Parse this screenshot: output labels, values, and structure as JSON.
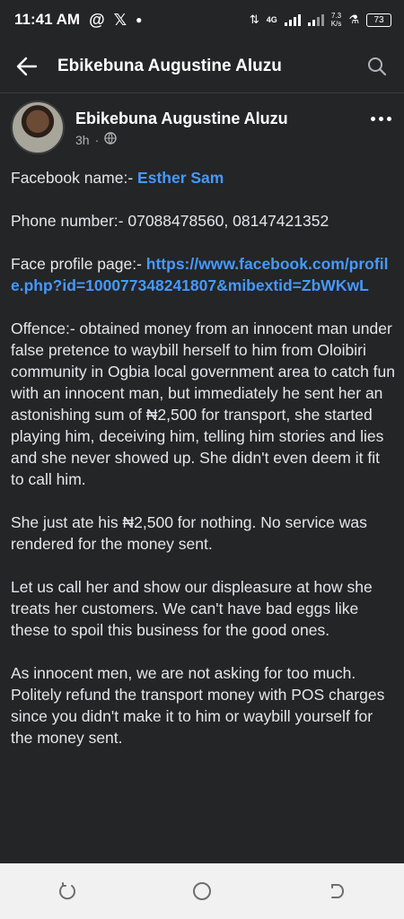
{
  "status_bar": {
    "time": "11:41 AM",
    "network": "4G",
    "speed_value": "7.3",
    "speed_unit": "K/s",
    "battery": "73"
  },
  "app_bar": {
    "title": "Ebikebuna Augustine Aluzu"
  },
  "post": {
    "author": "Ebikebuna Augustine Aluzu",
    "time_ago": "3h",
    "separator": "·",
    "facebook_label": "Facebook name:- ",
    "facebook_name": "Esther Sam",
    "phone_text": "Phone number:- 07088478560, 08147421352",
    "profile_label": "Face profile page:- ",
    "profile_link": "https://www.facebook.com/profile.php?id=100077348241807&mibextid=ZbWKwL",
    "offence": "Offence:- obtained money from an innocent man under false pretence to waybill herself to him from Oloibiri community in Ogbia local government area to catch fun with an innocent man, but immediately he sent her an astonishing sum of ₦2,500 for transport, she started playing him, deceiving him, telling him stories and lies and she never showed up. She didn't even deem it fit to call him.",
    "paragraph_2": "She just ate his ₦2,500 for nothing. No service was rendered for the money sent.",
    "paragraph_3": "Let us call her and show our displeasure at how she treats her customers. We can't have bad eggs like these to spoil this business for the good ones.",
    "paragraph_4": "As innocent men, we are not asking for too much. Politely refund the transport money with POS charges since you didn't make it to him or waybill yourself for the money sent."
  },
  "colors": {
    "background": "#242526",
    "link": "#4599ff",
    "nav_bar": "#f1f1f1"
  },
  "icons": [
    "back-arrow-icon",
    "search-icon",
    "globe-icon",
    "more-icon",
    "recents-icon",
    "home-icon",
    "back-icon"
  ]
}
